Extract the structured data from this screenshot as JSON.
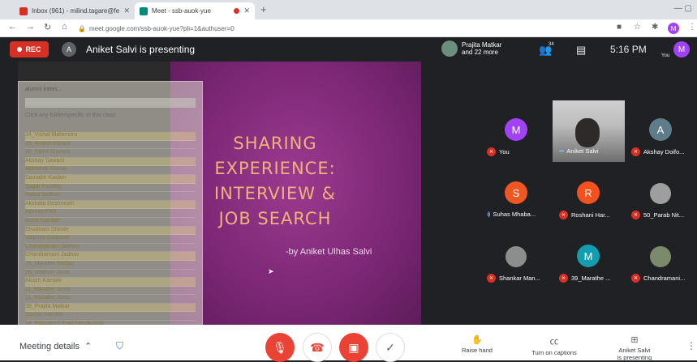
{
  "browser": {
    "tabs": [
      {
        "title": "Inbox (961) - milind.tagare@fer",
        "favicon_color": "#d93025"
      },
      {
        "title": "Meet - ssb-auok-yue",
        "favicon_color": "#00897b"
      }
    ],
    "new_tab": "+",
    "url": "meet.google.com/ssb-auok-yue?pli=1&authuser=0",
    "profile_initial": "M"
  },
  "meet": {
    "rec_label": "REC",
    "presenter_initial": "A",
    "presenting_text": "Aniket Salvi is presenting",
    "pinned_participant": "Prajita Matkar",
    "pinned_more": "and 22 more",
    "participant_count": "34",
    "time": "5:16 PM",
    "you_initial": "M",
    "you_label": "You"
  },
  "slide": {
    "title_lines": [
      "SHARING",
      "EXPERIENCE:",
      "INTERVIEW &",
      "JOB SEARCH"
    ],
    "byline": "-by Aniket Ulhas Salvi"
  },
  "overlay_window": {
    "title": "alumni inters...",
    "hint": "Click any folder/specific to this class",
    "rows": [
      "34_Vishal Mahendra",
      "35_Anand Vasant",
      "20_Nikhil Sharma",
      "Akshay Sawant",
      "Abhishek Kumar",
      "Saurabh Kadam",
      "Sagar Pandey",
      "Rahul Jadhav",
      "Akshata Deshmukh",
      "Akshay Patil",
      "Rohit Kamble",
      "Shubham Shinde",
      "Vaibhav Gaikwad",
      "Chandramani Jadhav",
      "Chandramani Jadhav",
      "39_Marathe Rohan",
      "26_Vaibhav Joshi",
      "Akash Kamble",
      "11_Marathe Suraj",
      "11_Marathe Suraj",
      "38_Prajita Matkar",
      "Sachin Kamble",
      "24_Raosaheb Patil Nandkumar"
    ]
  },
  "participants": [
    {
      "name": "You",
      "initial": "M",
      "color": "#a142f4",
      "muted": true,
      "type": "avatar"
    },
    {
      "name": "Aniket Salvi",
      "initial": "",
      "color": "",
      "muted": false,
      "type": "video"
    },
    {
      "name": "Akshay Doifo...",
      "initial": "A",
      "color": "#5f7c8a",
      "muted": true,
      "type": "avatar"
    },
    {
      "name": "Suhas Mhaba...",
      "initial": "S",
      "color": "#ee5622",
      "muted": false,
      "type": "avatar"
    },
    {
      "name": "Roshani Har...",
      "initial": "R",
      "color": "#f4511e",
      "muted": true,
      "type": "avatar"
    },
    {
      "name": "50_Parab Nit...",
      "initial": "",
      "color": "#9e9e9e",
      "muted": true,
      "type": "photo"
    },
    {
      "name": "Shankar Man...",
      "initial": "",
      "color": "#8d8d8d",
      "muted": true,
      "type": "photo"
    },
    {
      "name": "39_Marathe ...",
      "initial": "M",
      "color": "#129eaf",
      "muted": true,
      "type": "avatar"
    },
    {
      "name": "Chandramani...",
      "initial": "",
      "color": "#7a8a6a",
      "muted": true,
      "type": "photo"
    }
  ],
  "controls": {
    "meeting_details": "Meeting details",
    "raise_hand": "Raise hand",
    "captions": "Turn on captions",
    "presenting_line1": "Aniket Salvi",
    "presenting_line2": "is presenting"
  }
}
